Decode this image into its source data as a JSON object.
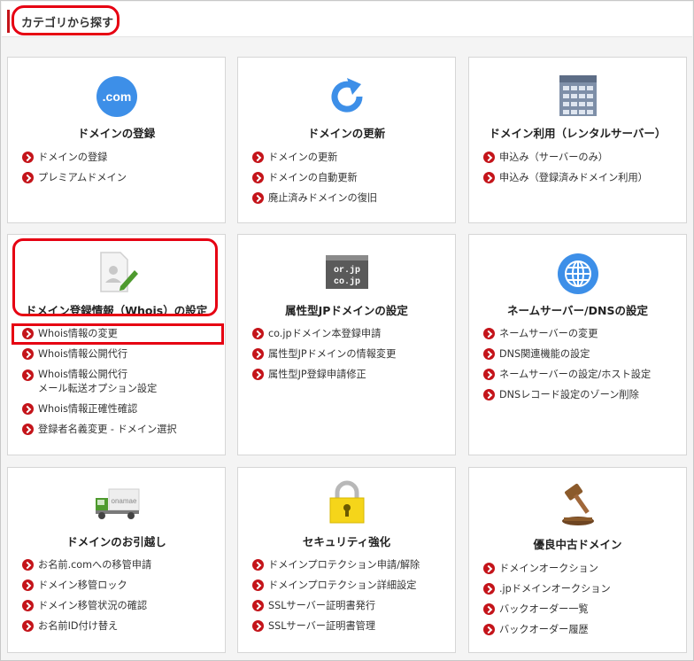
{
  "header": {
    "title": "カテゴリから探す"
  },
  "cards": [
    {
      "title": "ドメインの登録",
      "icon": "dotcom-icon",
      "icon_text": ".com",
      "links": [
        "ドメインの登録",
        "プレミアムドメイン"
      ]
    },
    {
      "title": "ドメインの更新",
      "icon": "refresh-icon",
      "links": [
        "ドメインの更新",
        "ドメインの自動更新",
        "廃止済みドメインの復旧"
      ]
    },
    {
      "title": "ドメイン利用（レンタルサーバー）",
      "icon": "server-icon",
      "links": [
        "申込み（サーバーのみ）",
        "申込み（登録済みドメイン利用）"
      ]
    },
    {
      "title": "ドメイン登録情報（Whois）の設定",
      "icon": "document-edit-icon",
      "links": [
        "Whois情報の変更",
        "Whois情報公開代行",
        "Whois情報公開代行\nメール転送オプション設定",
        "Whois情報正確性確認",
        "登録者名義変更 - ドメイン選択"
      ]
    },
    {
      "title": "属性型JPドメインの設定",
      "icon": "jp-domain-icon",
      "icon_text_1": "or.jp",
      "icon_text_2": "co.jp",
      "links": [
        "co.jpドメイン本登録申請",
        "属性型JPドメインの情報変更",
        "属性型JP登録申請修正"
      ]
    },
    {
      "title": "ネームサーバー/DNSの設定",
      "icon": "globe-icon",
      "links": [
        "ネームサーバーの変更",
        "DNS関連機能の設定",
        "ネームサーバーの設定/ホスト設定",
        "DNSレコード設定のゾーン削除"
      ]
    },
    {
      "title": "ドメインのお引越し",
      "icon": "moving-truck-icon",
      "icon_text": "onamae",
      "links": [
        "お名前.comへの移管申請",
        "ドメイン移管ロック",
        "ドメイン移管状況の確認",
        "お名前ID付け替え"
      ]
    },
    {
      "title": "セキュリティ強化",
      "icon": "padlock-icon",
      "links": [
        "ドメインプロテクション申請/解除",
        "ドメインプロテクション詳細設定",
        "SSLサーバー証明書発行",
        "SSLサーバー証明書管理"
      ]
    },
    {
      "title": "優良中古ドメイン",
      "icon": "auction-gavel-icon",
      "links": [
        "ドメインオークション",
        ".jpドメインオークション",
        "バックオーダー一覧",
        "バックオーダー履歴"
      ]
    }
  ],
  "colors": {
    "accent": "#c4141a",
    "highlight": "#e60012",
    "icon_blue": "#3d8fe8"
  }
}
